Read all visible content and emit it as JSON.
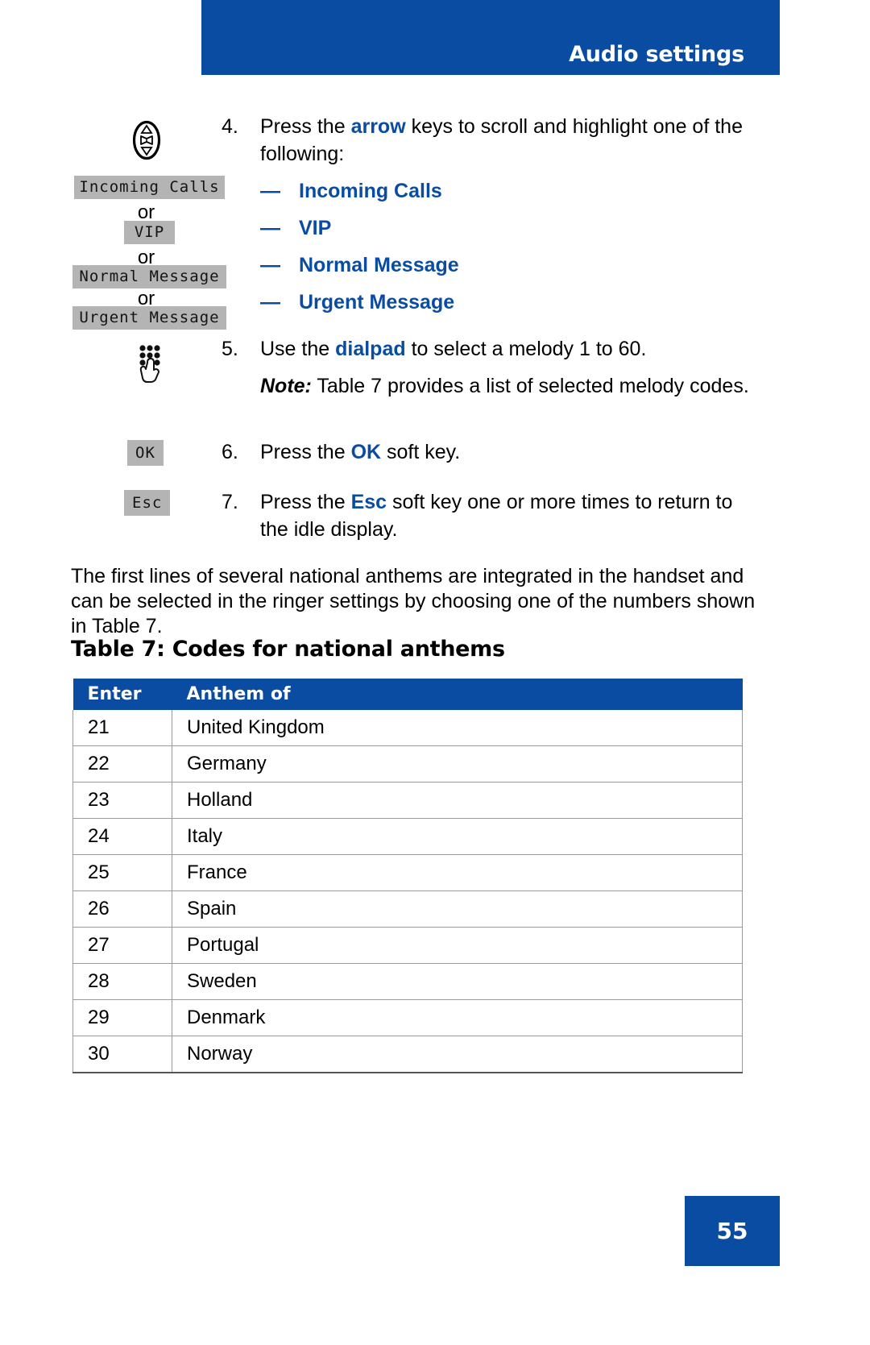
{
  "header": {
    "title": "Audio settings",
    "bar_color": "#0a4ca2"
  },
  "steps": [
    {
      "number": "4.",
      "text_before": "Press the ",
      "emphasis": "arrow",
      "text_after": " keys to scroll and highlight one of the following:",
      "icon": "arrow-keys-icon"
    },
    {
      "number": "5.",
      "text_before": "Use the ",
      "emphasis": "dialpad",
      "text_after": " to select a melody 1 to 60.",
      "icon": "dialpad-icon",
      "note_label": "Note:",
      "note_text": " Table 7 provides a list of selected melody codes."
    },
    {
      "number": "6.",
      "text_before": "Press the ",
      "emphasis": "OK",
      "text_after": " soft key.",
      "icon": "ok-softkey"
    },
    {
      "number": "7.",
      "text_before": "Press the ",
      "emphasis": "Esc",
      "text_after": " soft key one or more times to return to the idle display.",
      "icon": "esc-softkey"
    }
  ],
  "sub_items": [
    {
      "dash": "—",
      "label": "Incoming Calls"
    },
    {
      "dash": "—",
      "label": "VIP"
    },
    {
      "dash": "—",
      "label": "Normal Message"
    },
    {
      "dash": "—",
      "label": "Urgent Message"
    }
  ],
  "lcd_labels": [
    {
      "text": "Incoming Calls"
    },
    {
      "text": "VIP"
    },
    {
      "text": "Normal Message"
    },
    {
      "text": "Urgent Message"
    }
  ],
  "or_separators": [
    "or",
    "or",
    "or"
  ],
  "softkeys": {
    "ok": "OK",
    "esc": "Esc"
  },
  "paragraph": "The first lines of several national anthems are integrated in the handset and can be selected in the ringer settings by choosing one of the numbers shown in Table 7.",
  "table": {
    "caption": "Table 7: Codes for national anthems",
    "header_color": "#0a4ca2",
    "columns": [
      "Enter",
      "Anthem of"
    ],
    "rows": [
      [
        "21",
        "United Kingdom"
      ],
      [
        "22",
        "Germany"
      ],
      [
        "23",
        "Holland"
      ],
      [
        "24",
        "Italy"
      ],
      [
        "25",
        "France"
      ],
      [
        "26",
        "Spain"
      ],
      [
        "27",
        "Portugal"
      ],
      [
        "28",
        "Sweden"
      ],
      [
        "29",
        "Denmark"
      ],
      [
        "30",
        "Norway"
      ]
    ]
  },
  "footer": {
    "page_number": "55"
  }
}
